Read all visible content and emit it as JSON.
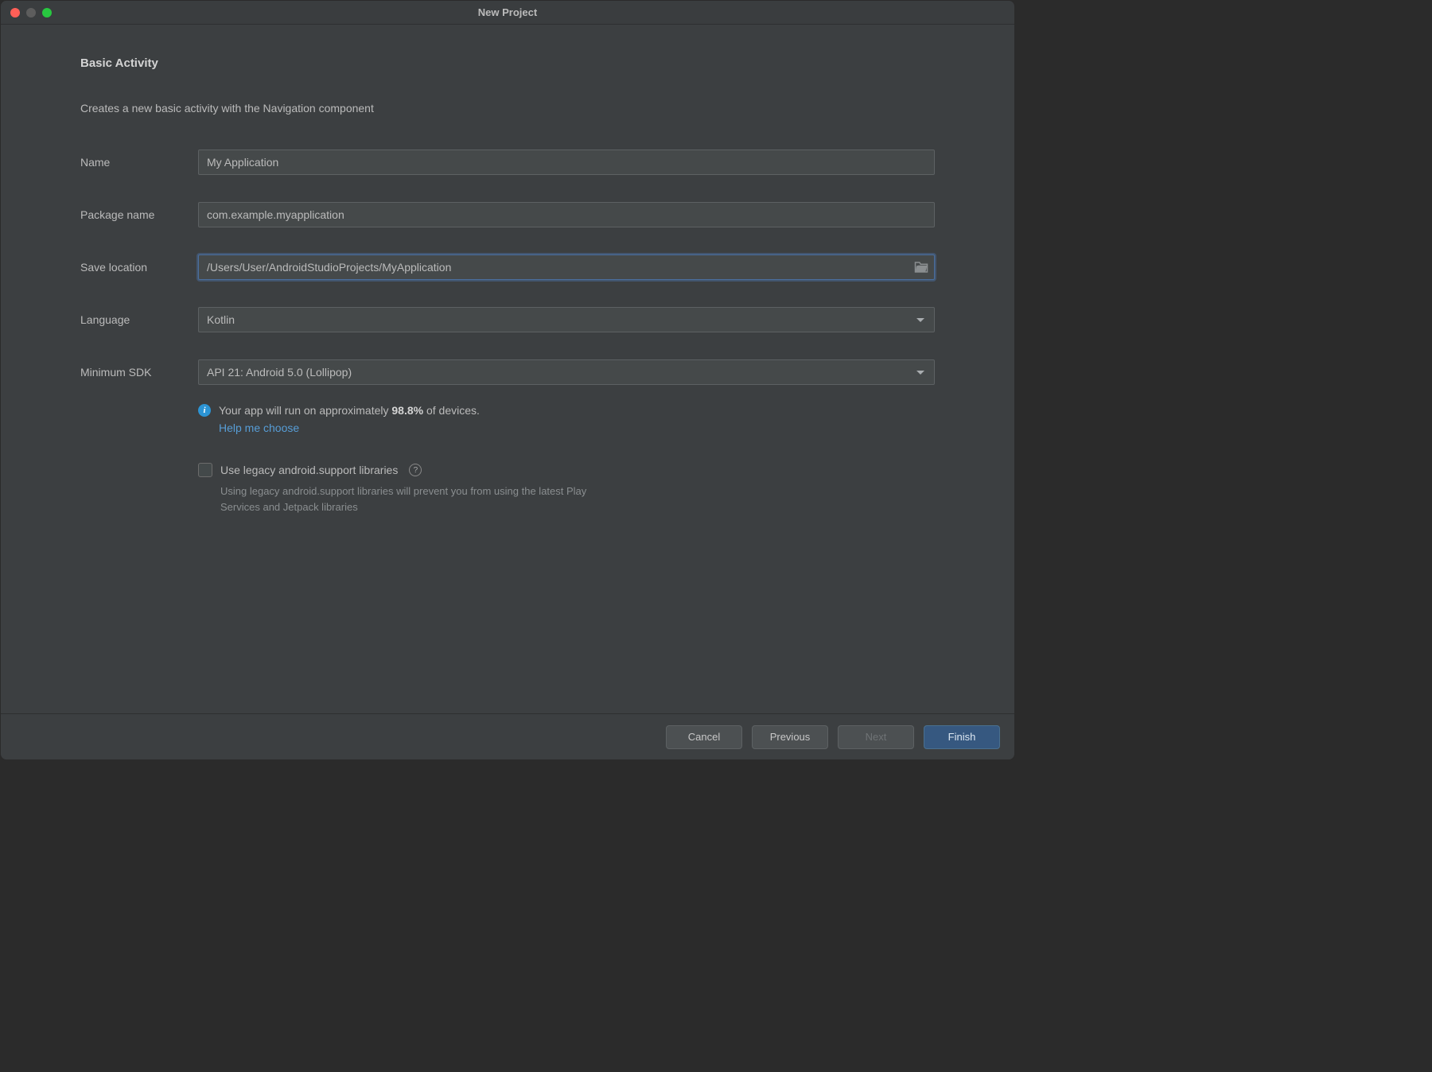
{
  "window": {
    "title": "New Project"
  },
  "page": {
    "heading": "Basic Activity",
    "description": "Creates a new basic activity with the Navigation component"
  },
  "form": {
    "name": {
      "label": "Name",
      "value": "My Application"
    },
    "package": {
      "label": "Package name",
      "value": "com.example.myapplication"
    },
    "location": {
      "label": "Save location",
      "value": "/Users/User/AndroidStudioProjects/MyApplication"
    },
    "language": {
      "label": "Language",
      "value": "Kotlin"
    },
    "min_sdk": {
      "label": "Minimum SDK",
      "value": "API 21: Android 5.0 (Lollipop)"
    }
  },
  "info": {
    "text_prefix": "Your app will run on approximately ",
    "percentage": "98.8%",
    "text_suffix": " of devices.",
    "help_link": "Help me choose"
  },
  "legacy": {
    "label": "Use legacy android.support libraries",
    "description": "Using legacy android.support libraries will prevent you from using the latest Play Services and Jetpack libraries",
    "checked": false
  },
  "buttons": {
    "cancel": "Cancel",
    "previous": "Previous",
    "next": "Next",
    "finish": "Finish"
  }
}
